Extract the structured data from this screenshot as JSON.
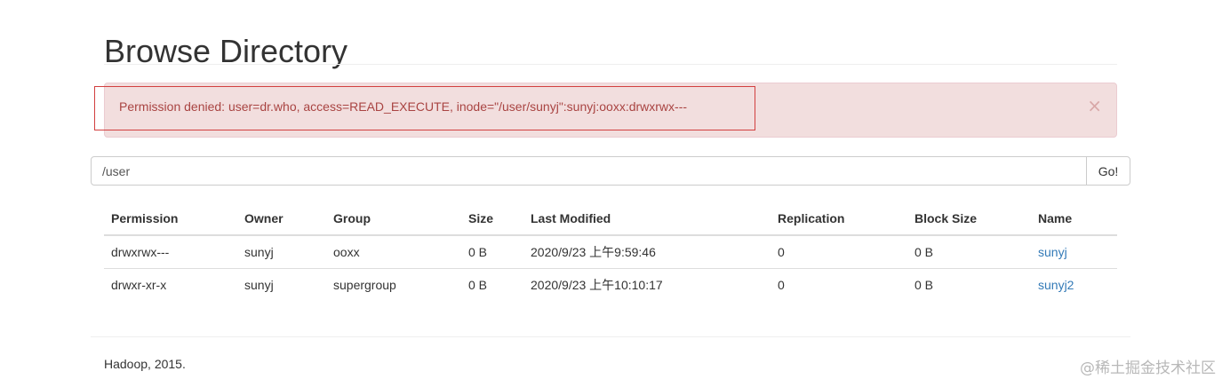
{
  "page": {
    "title": "Browse Directory"
  },
  "alert": {
    "message": "Permission denied: user=dr.who, access=READ_EXECUTE, inode=\"/user/sunyj\":sunyj:ooxx:drwxrwx---",
    "close_glyph": "×"
  },
  "search": {
    "path_value": "/user",
    "go_label": "Go!"
  },
  "table": {
    "headers": [
      "Permission",
      "Owner",
      "Group",
      "Size",
      "Last Modified",
      "Replication",
      "Block Size",
      "Name"
    ],
    "rows": [
      {
        "permission": "drwxrwx---",
        "owner": "sunyj",
        "group": "ooxx",
        "size": "0 B",
        "last_modified": "2020/9/23 上午9:59:46",
        "replication": "0",
        "block_size": "0 B",
        "name": "sunyj"
      },
      {
        "permission": "drwxr-xr-x",
        "owner": "sunyj",
        "group": "supergroup",
        "size": "0 B",
        "last_modified": "2020/9/23 上午10:10:17",
        "replication": "0",
        "block_size": "0 B",
        "name": "sunyj2"
      }
    ]
  },
  "footer": {
    "text": "Hadoop, 2015."
  },
  "watermark": {
    "text": "@稀土掘金技术社区"
  },
  "colors": {
    "alert_bg": "#f2dede",
    "alert_text": "#a94442",
    "link": "#337ab7",
    "highlight_border": "#d23f3f"
  }
}
